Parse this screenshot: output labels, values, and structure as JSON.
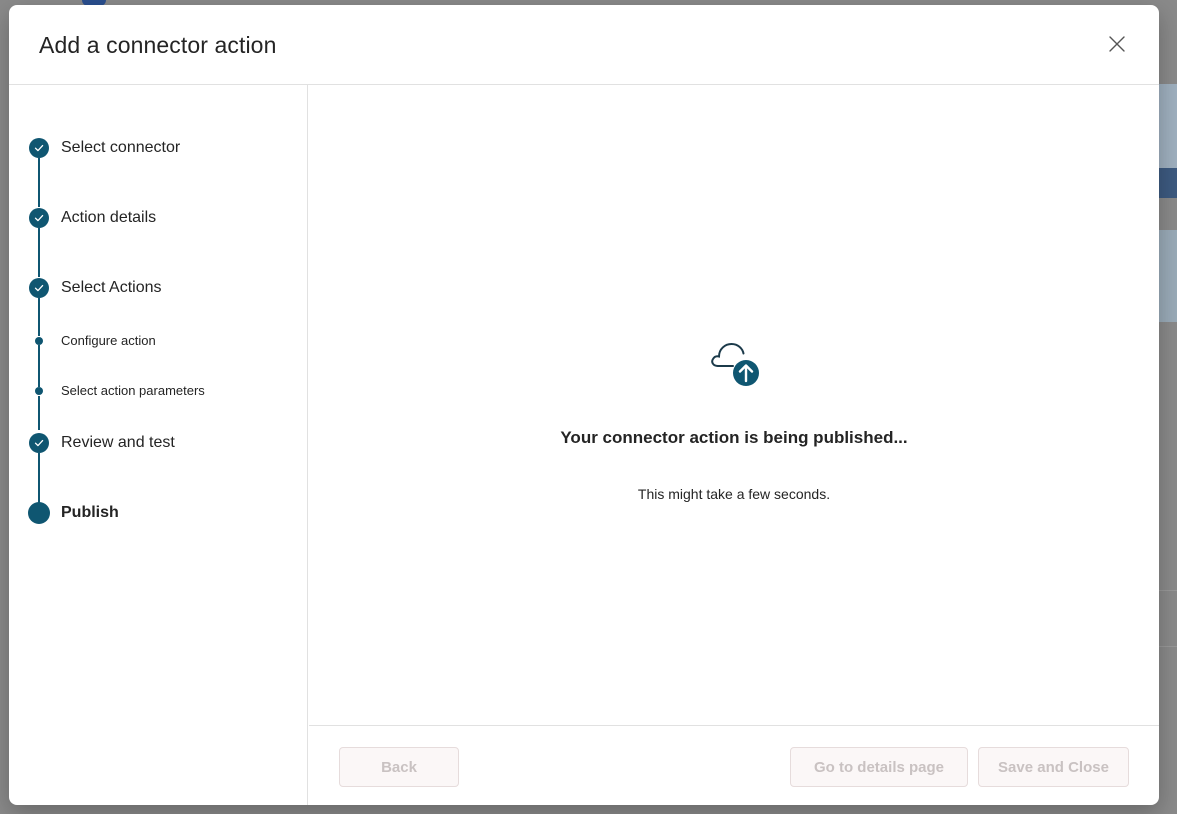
{
  "dialog": {
    "title": "Add a connector action",
    "close_icon": "close-icon"
  },
  "steps": [
    {
      "label": "Select connector",
      "state": "completed",
      "level": "main"
    },
    {
      "label": "Action details",
      "state": "completed",
      "level": "main"
    },
    {
      "label": "Select Actions",
      "state": "completed",
      "level": "main"
    },
    {
      "label": "Configure action",
      "state": "completed",
      "level": "sub"
    },
    {
      "label": "Select action parameters",
      "state": "completed",
      "level": "sub"
    },
    {
      "label": "Review and test",
      "state": "completed",
      "level": "main"
    },
    {
      "label": "Publish",
      "state": "current",
      "level": "main"
    }
  ],
  "content": {
    "icon": "cloud-upload-icon",
    "heading": "Your connector action is being published...",
    "subtext": "This might take a few seconds."
  },
  "footer": {
    "back_label": "Back",
    "details_label": "Go to details page",
    "save_label": "Save and Close"
  },
  "colors": {
    "accent": "#0f5671",
    "disabled_text": "#c9c2c2",
    "disabled_bg": "#fbf7f7"
  }
}
